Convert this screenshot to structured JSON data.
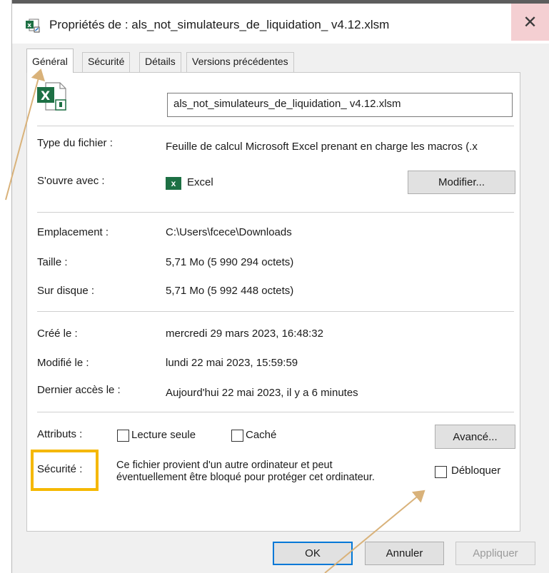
{
  "window": {
    "title": "Propriétés de : als_not_simulateurs_de_liquidation_ v4.12.xlsm",
    "close_glyph": "✕",
    "file_icon_letter": "X"
  },
  "tabs": [
    {
      "label": "Général",
      "active": true
    },
    {
      "label": "Sécurité",
      "active": false
    },
    {
      "label": "Détails",
      "active": false
    },
    {
      "label": "Versions précédentes",
      "active": false
    }
  ],
  "general": {
    "filename": "als_not_simulateurs_de_liquidation_ v4.12.xlsm",
    "type_label": "Type du fichier :",
    "type_value": "Feuille de calcul Microsoft Excel prenant en charge les macros (.x",
    "opens_label": "S'ouvre avec :",
    "opens_app_icon": "x",
    "opens_value": "Excel",
    "change_button": "Modifier...",
    "location_label": "Emplacement :",
    "location_value": "C:\\Users\\fcece\\Downloads",
    "size_label": "Taille :",
    "size_value": "5,71 Mo (5 990 294 octets)",
    "disk_label": "Sur disque :",
    "disk_value": "5,71 Mo (5 992 448 octets)",
    "created_label": "Créé le :",
    "created_value": "mercredi 29 mars 2023, 16:48:32",
    "modified_label": "Modifié le :",
    "modified_value": "lundi 22 mai 2023, 15:59:59",
    "accessed_label": "Dernier accès le :",
    "accessed_value": "Aujourd'hui 22 mai 2023, il y a 6 minutes",
    "attributes_label": "Attributs :",
    "readonly_label": "Lecture seule",
    "readonly_checked": false,
    "hidden_label": "Caché",
    "hidden_checked": false,
    "advanced_button": "Avancé...",
    "security_label": "Sécurité :",
    "security_text_line1": "Ce fichier provient d'un autre ordinateur et peut",
    "security_text_line2": "éventuellement être bloqué pour protéger cet ordinateur.",
    "unblock_label": "Débloquer",
    "unblock_checked": false
  },
  "footer": {
    "ok": "OK",
    "cancel": "Annuler",
    "apply": "Appliquer"
  },
  "colors": {
    "highlight": "#f5b800",
    "arrow": "#d9b27a",
    "excel_green": "#1d7044",
    "focus_blue": "#0078d7"
  }
}
